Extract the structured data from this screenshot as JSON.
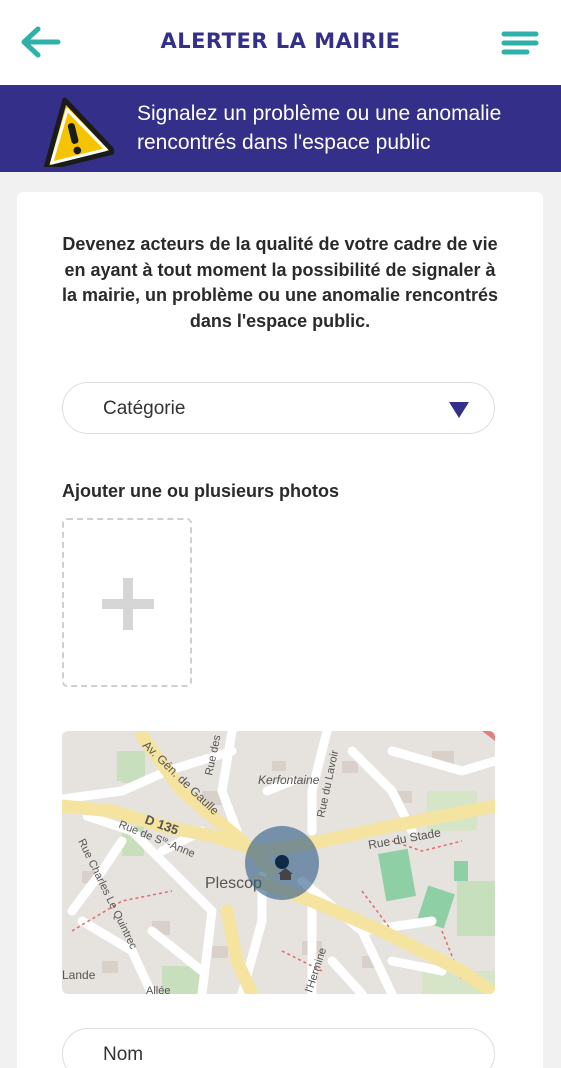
{
  "header": {
    "title": "ALERTER LA MAIRIE",
    "back_icon": "arrow-left-icon",
    "menu_icon": "hamburger-menu-icon",
    "accent_color": "#2fb0a8",
    "brand_color": "#34308a"
  },
  "banner": {
    "icon": "warning-icon",
    "line1": "Signalez un problème ou une anomalie",
    "line2": "rencontrés dans l'espace public"
  },
  "form": {
    "intro_line1": "Devenez acteurs de la qualité de votre cadre de vie",
    "intro_line2": "en ayant à tout moment la possibilité de signaler à",
    "intro_line3": "la mairie, un problème ou une anomalie rencontrés",
    "intro_line4": "dans l'espace public.",
    "category_placeholder": "Catégorie",
    "photos_label": "Ajouter une ou plusieurs photos",
    "photo_add_icon": "plus-icon",
    "name_placeholder": "Nom"
  },
  "map": {
    "labels": {
      "av_gen_de_gaulle": "Av. Gén. de Gaulle",
      "rue_des": "Rue des",
      "kerfontaine": "Kerfontaine",
      "rue_du_lavoir": "Rue du Lavoir",
      "d135": "D 135",
      "rue_sainte_anne": "Rue de S",
      "rue_sainte_anne_sup": "te",
      "rue_sainte_anne_end": "-Anne",
      "rue_du_stade": "Rue du Stade",
      "rue_charles": "Rue Charles Le Quintrec",
      "plescop": "Plescop",
      "lande": "Lande",
      "allee": "Allée",
      "hermine": "l'Hermine"
    }
  }
}
